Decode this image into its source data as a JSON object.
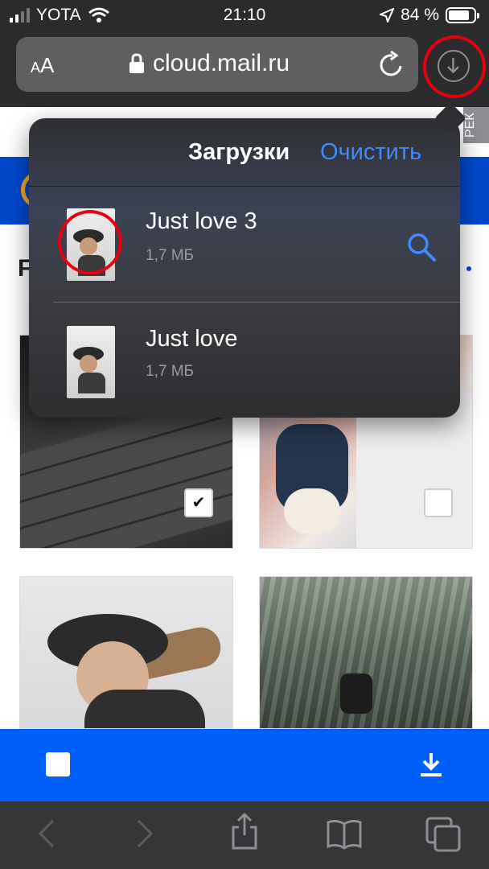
{
  "status_bar": {
    "carrier": "YOTA",
    "time": "21:10",
    "battery": "84 %"
  },
  "browser": {
    "text_size_label_small": "A",
    "text_size_label_large": "A",
    "url": "cloud.mail.ru"
  },
  "page": {
    "ad_label": "РЕК",
    "section_title": "F",
    "photos_selected": [
      false,
      false,
      true,
      false
    ]
  },
  "downloads": {
    "title": "Загрузки",
    "clear_label": "Очистить",
    "items": [
      {
        "name": "Just love 3",
        "size": "1,7 МБ"
      },
      {
        "name": "Just love",
        "size": "1,7 МБ"
      }
    ]
  },
  "icons": [
    "signal-icon",
    "wifi-icon",
    "location-icon",
    "battery-icon",
    "lock-icon",
    "reload-icon",
    "download-icon",
    "search-icon",
    "back-icon",
    "forward-icon",
    "share-icon",
    "bookmarks-icon",
    "tabs-icon",
    "checkmark-icon"
  ],
  "colors": {
    "accent_blue": "#005ff9",
    "link_blue": "#3c8cff",
    "highlight_red": "#e8000f",
    "mail_blue": "#0047cc"
  }
}
